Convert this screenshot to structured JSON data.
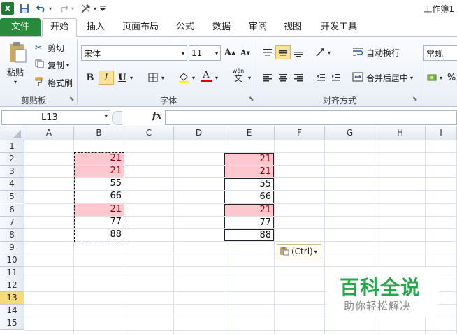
{
  "quick_access": {
    "separator_label": "|"
  },
  "app_title": "工作簿1",
  "tabs": [
    "文件",
    "开始",
    "插入",
    "页面布局",
    "公式",
    "数据",
    "审阅",
    "视图",
    "开发工具"
  ],
  "clipboard": {
    "paste": "粘贴",
    "cut": "剪切",
    "copy": "复制",
    "format_painter": "格式刷",
    "group": "剪贴板"
  },
  "font": {
    "name": "宋体",
    "size": "11",
    "bold": "B",
    "italic": "I",
    "underline": "U",
    "grow": "A",
    "shrink": "A",
    "color_a": "A",
    "phonetic": "wén",
    "phonetic2": "文",
    "group": "字体"
  },
  "alignment": {
    "wrap": "自动换行",
    "merge": "合并后居中",
    "group": "对齐方式"
  },
  "number": {
    "format": "常规",
    "percent": "%"
  },
  "formula_bar": {
    "name_box": "L13",
    "fx": "fx"
  },
  "columns": [
    "A",
    "B",
    "C",
    "D",
    "E",
    "F",
    "G",
    "H",
    "I"
  ],
  "rows": [
    "1",
    "2",
    "3",
    "4",
    "5",
    "6",
    "7",
    "8",
    "9",
    "10",
    "11",
    "12",
    "13",
    "14",
    "15"
  ],
  "selected_row": "13",
  "colors": {
    "accent_green": "#2a8a3c",
    "pink_fill": "#ffc7ce",
    "pink_text": "#9c0006",
    "selected_row": "#f9d978"
  },
  "column_b": [
    "21",
    "21",
    "55",
    "66",
    "21",
    "77",
    "88"
  ],
  "column_e": [
    "21",
    "21",
    "55",
    "66",
    "21",
    "77",
    "88"
  ],
  "pink_rows": [
    0,
    1,
    4
  ],
  "paste_options": {
    "label": "(Ctrl)"
  },
  "watermark": {
    "title": "百科全说",
    "subtitle": "助你轻松解决"
  }
}
